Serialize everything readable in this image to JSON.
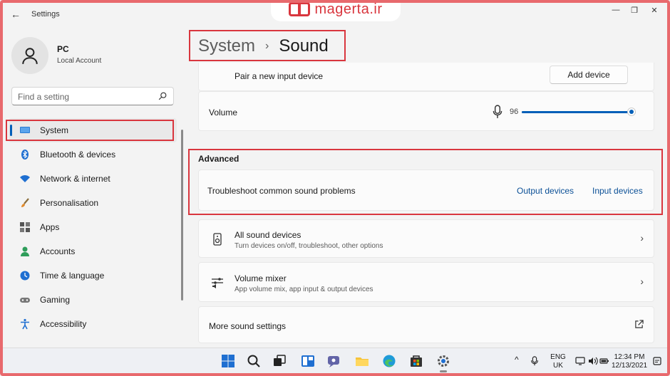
{
  "watermark": {
    "text": "magerta.ir"
  },
  "titlebar": {
    "title": "Settings",
    "back_icon": "←",
    "minimize_icon": "—",
    "maximize_icon": "❐",
    "close_icon": "✕"
  },
  "profile": {
    "name": "PC",
    "subtitle": "Local Account"
  },
  "search": {
    "placeholder": "Find a setting"
  },
  "nav": {
    "items": [
      {
        "label": "System",
        "icon": "monitor-icon",
        "active": true
      },
      {
        "label": "Bluetooth & devices",
        "icon": "bluetooth-icon"
      },
      {
        "label": "Network & internet",
        "icon": "wifi-icon"
      },
      {
        "label": "Personalisation",
        "icon": "brush-icon"
      },
      {
        "label": "Apps",
        "icon": "apps-icon"
      },
      {
        "label": "Accounts",
        "icon": "account-icon"
      },
      {
        "label": "Time & language",
        "icon": "globe-clock-icon"
      },
      {
        "label": "Gaming",
        "icon": "gamepad-icon"
      },
      {
        "label": "Accessibility",
        "icon": "accessibility-icon"
      }
    ]
  },
  "breadcrumb": {
    "parent": "System",
    "separator": "›",
    "current": "Sound"
  },
  "main": {
    "pair_input": {
      "label": "Pair a new input device",
      "button": "Add device"
    },
    "volume": {
      "label": "Volume",
      "value": "96",
      "level": 0.96
    },
    "advanced": {
      "title": "Advanced",
      "troubleshoot_label": "Troubleshoot common sound problems",
      "output_link": "Output devices",
      "input_link": "Input devices"
    },
    "all_devices": {
      "label": "All sound devices",
      "subtitle": "Turn devices on/off, troubleshoot, other options",
      "chevron": "›"
    },
    "mixer": {
      "label": "Volume mixer",
      "subtitle": "App volume mix, app input & output devices",
      "chevron": "›"
    },
    "more_settings": {
      "label": "More sound settings"
    }
  },
  "taskbar": {
    "tray_chevron": "^",
    "lang_line1": "ENG",
    "lang_line2": "UK",
    "time": "12:34 PM",
    "date": "12/13/2021"
  },
  "colors": {
    "accent": "#005fb8",
    "highlight_box": "#d9363e"
  }
}
